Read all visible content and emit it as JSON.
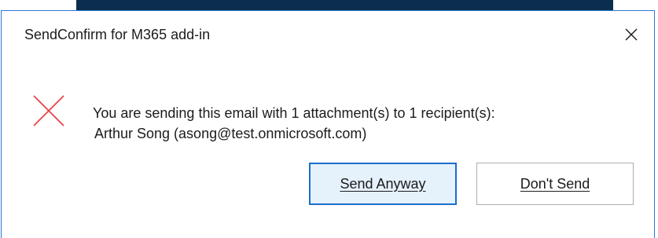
{
  "dialog": {
    "title": "SendConfirm for M365 add-in",
    "close_icon": "close-icon",
    "status_icon": "error-x-icon",
    "status_color": "#e8444a",
    "accent_color": "#1a6fc9",
    "message_line1": "You are sending this email with 1 attachment(s) to 1 recipient(s):",
    "message_line2": "Arthur Song (asong@test.onmicrosoft.com)",
    "buttons": {
      "send_anyway": "Send Anyway",
      "dont_send": "Don't Send"
    }
  }
}
